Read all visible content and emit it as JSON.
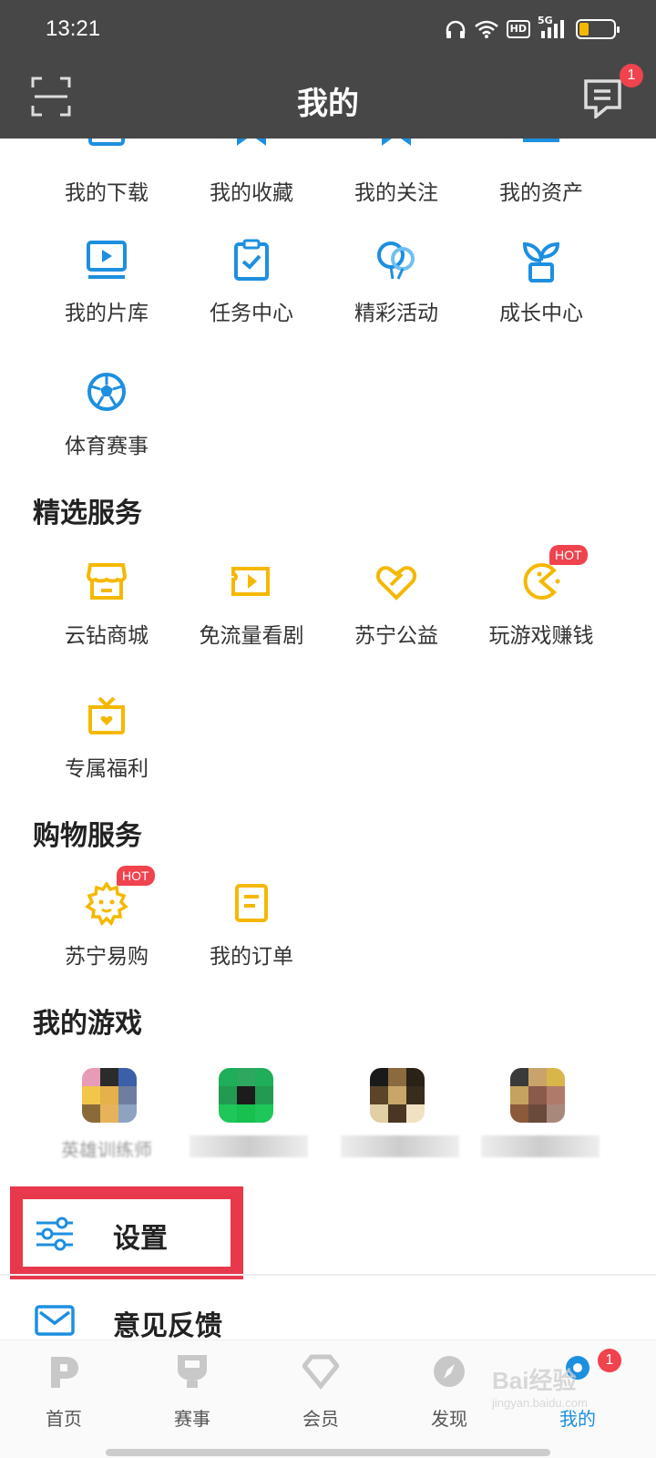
{
  "status_bar": {
    "time": "13:21",
    "network": "5G",
    "hd": "HD"
  },
  "header": {
    "title": "我的",
    "message_badge": "1"
  },
  "colors": {
    "blue": "#1d8fe0",
    "yellow": "#f5b800",
    "red": "#f0434d",
    "header_bg": "#474747"
  },
  "my_tools_row1": [
    {
      "label": "我的下载",
      "icon": "download-icon"
    },
    {
      "label": "我的收藏",
      "icon": "bookmark-icon"
    },
    {
      "label": "我的关注",
      "icon": "follow-icon"
    },
    {
      "label": "我的资产",
      "icon": "wallet-icon"
    }
  ],
  "my_tools_row2": [
    {
      "label": "我的片库",
      "icon": "video-library-icon"
    },
    {
      "label": "任务中心",
      "icon": "task-clipboard-icon"
    },
    {
      "label": "精彩活动",
      "icon": "balloon-icon"
    },
    {
      "label": "成长中心",
      "icon": "sprout-icon"
    }
  ],
  "my_tools_row3": [
    {
      "label": "体育赛事",
      "icon": "football-icon"
    }
  ],
  "featured_services": {
    "title": "精选服务",
    "items": [
      {
        "label": "云钻商城",
        "icon": "store-icon"
      },
      {
        "label": "免流量看剧",
        "icon": "ticket-play-icon"
      },
      {
        "label": "苏宁公益",
        "icon": "charity-heart-icon"
      },
      {
        "label": "玩游戏赚钱",
        "icon": "pacman-icon",
        "badge": "HOT"
      },
      {
        "label": "专属福利",
        "icon": "gift-icon"
      }
    ]
  },
  "shopping_services": {
    "title": "购物服务",
    "items": [
      {
        "label": "苏宁易购",
        "icon": "suning-lion-icon",
        "badge": "HOT"
      },
      {
        "label": "我的订单",
        "icon": "order-icon"
      }
    ]
  },
  "my_games": {
    "title": "我的游戏",
    "items": [
      {
        "name": "英雄训练师",
        "icon": "game-1-icon"
      },
      {
        "name": "",
        "icon": "game-2-icon"
      },
      {
        "name": "",
        "icon": "game-3-icon"
      },
      {
        "name": "",
        "icon": "game-4-icon"
      }
    ]
  },
  "list": {
    "settings": "设置",
    "feedback": "意见反馈"
  },
  "bottom_nav": [
    {
      "label": "首页",
      "icon": "home-p-icon"
    },
    {
      "label": "赛事",
      "icon": "trophy-icon"
    },
    {
      "label": "会员",
      "icon": "diamond-icon"
    },
    {
      "label": "发现",
      "icon": "compass-icon"
    },
    {
      "label": "我的",
      "icon": "profile-icon",
      "active": true,
      "badge": "1"
    }
  ],
  "watermark": {
    "text": "Bai经验",
    "sub": "jingyan.baidu.com"
  }
}
